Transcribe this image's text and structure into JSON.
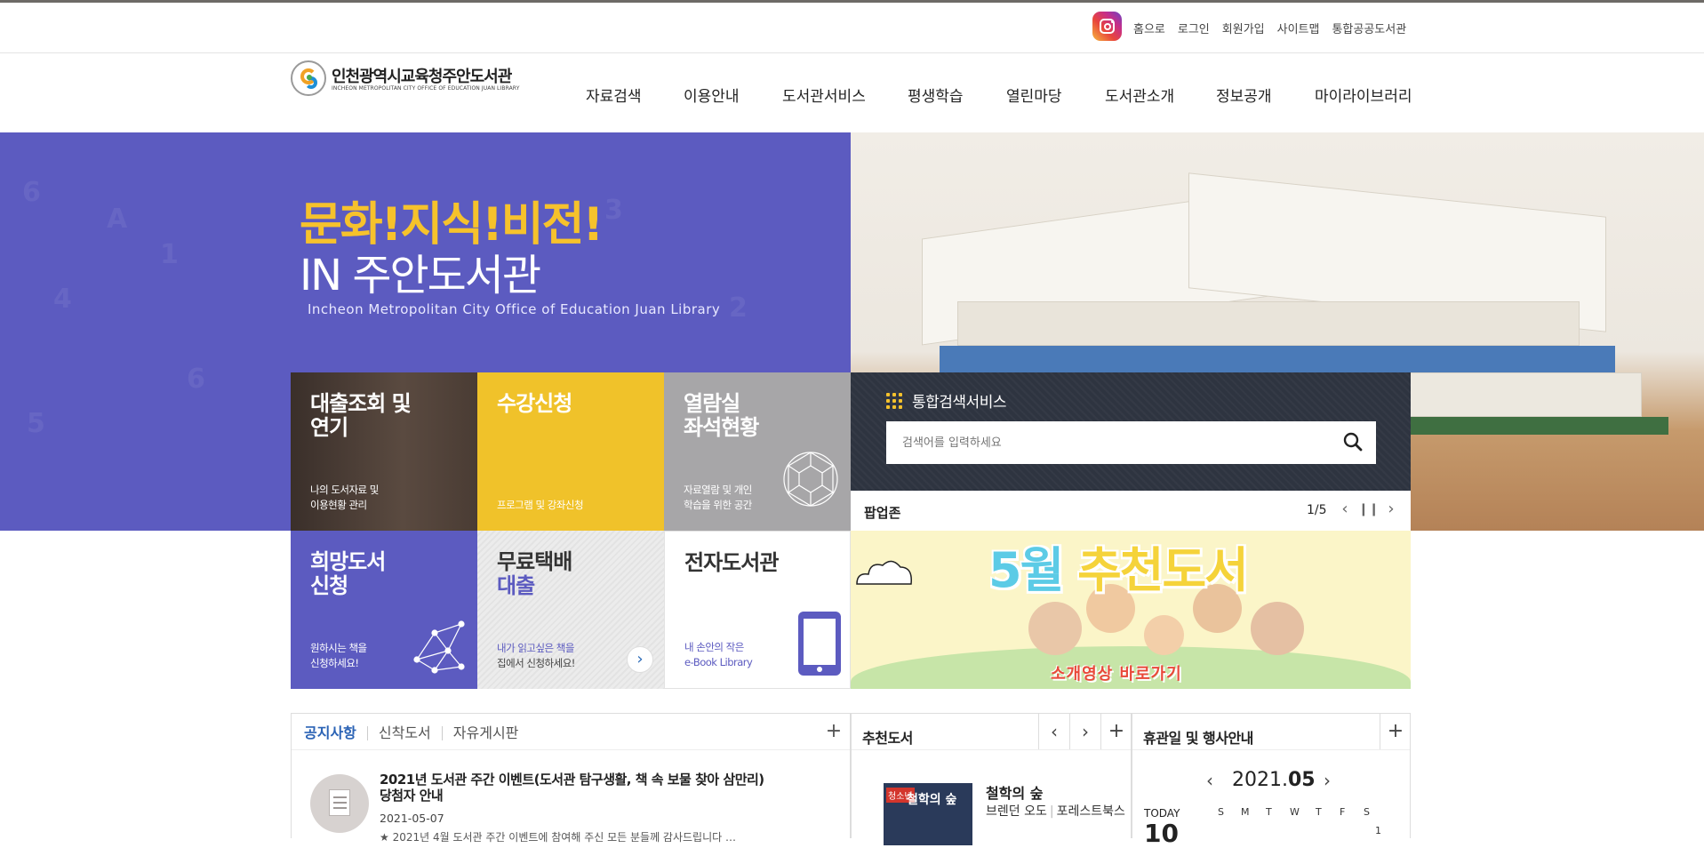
{
  "util": {
    "instagram_icon": "instagram-icon",
    "links": [
      "홈으로",
      "로그인",
      "회원가입",
      "사이트맵",
      "통합공공도서관"
    ]
  },
  "logo": {
    "name": "인천광역시교육청주안도서관",
    "eng": "INCHEON METROPOLITAN CITY OFFICE OF EDUCATION JUAN LIBRARY"
  },
  "gnb": [
    "자료검색",
    "이용안내",
    "도서관서비스",
    "평생학습",
    "열린마당",
    "도서관소개",
    "정보공개",
    "마이라이브러리"
  ],
  "hero": {
    "slogan_main": "문화!지식!비전!",
    "slogan_sub": "IN 주안도서관",
    "slogan_eng": "Incheon Metropolitan City Office of Education Juan Library"
  },
  "tiles": {
    "loan": {
      "title_1": "대출조회 및",
      "title_2": "연기",
      "desc_1": "나의 도서자료 및",
      "desc_2": "이용현황 관리"
    },
    "course": {
      "title": "수강신청",
      "desc": "프로그램 및 강좌신청"
    },
    "reading": {
      "title_1": "열람실",
      "title_2": "좌석현황",
      "desc_1": "자료열람 및 개인",
      "desc_2": "학습을 위한 공간"
    },
    "hope": {
      "title_1": "희망도서",
      "title_2": "신청",
      "desc_1": "원하시는 책을",
      "desc_2": "신청하세요!"
    },
    "delivery": {
      "title_1": "무료택배",
      "title_2": "대출",
      "desc_1": "내가 읽고싶은 책을",
      "desc_2": "집에서 신청하세요!"
    },
    "ebook": {
      "title": "전자도서관",
      "desc_1": "내 손안의 작은",
      "desc_2": "e-Book Library"
    }
  },
  "search": {
    "title": "통합검색서비스",
    "placeholder": "검색어를 입력하세요"
  },
  "popup": {
    "label": "팝업존",
    "counter": "1/5",
    "banner_head_1": "5월",
    "banner_head_2": "추천도서",
    "banner_sub": "소개영상 바로가기"
  },
  "notice": {
    "tabs": [
      "공지사항",
      "신착도서",
      "자유게시판"
    ],
    "title": "2021년 도서관 주간 이벤트(도서관 탐구생활, 책 속 보물 찾아 삼만리) 당첨자 안내",
    "date": "2021-05-07",
    "excerpt": "★ 2021년 4월 도서관 주간 이벤트에 참여해 주신 모든 분들께 감사드립니다 …"
  },
  "recommend": {
    "title": "추천도서",
    "cover_tag": "청소년",
    "cover_name": "철학의 숲",
    "book_title": "철학의 숲",
    "author": "브렌던 오도",
    "publisher": "포레스트북스"
  },
  "calendar": {
    "title": "휴관일 및 행사안내",
    "year": "2021.",
    "month": "05",
    "today_label": "TODAY",
    "today_num": "10",
    "weekdays": [
      "S",
      "M",
      "T",
      "W",
      "T",
      "F",
      "S"
    ],
    "first_day": "1"
  }
}
